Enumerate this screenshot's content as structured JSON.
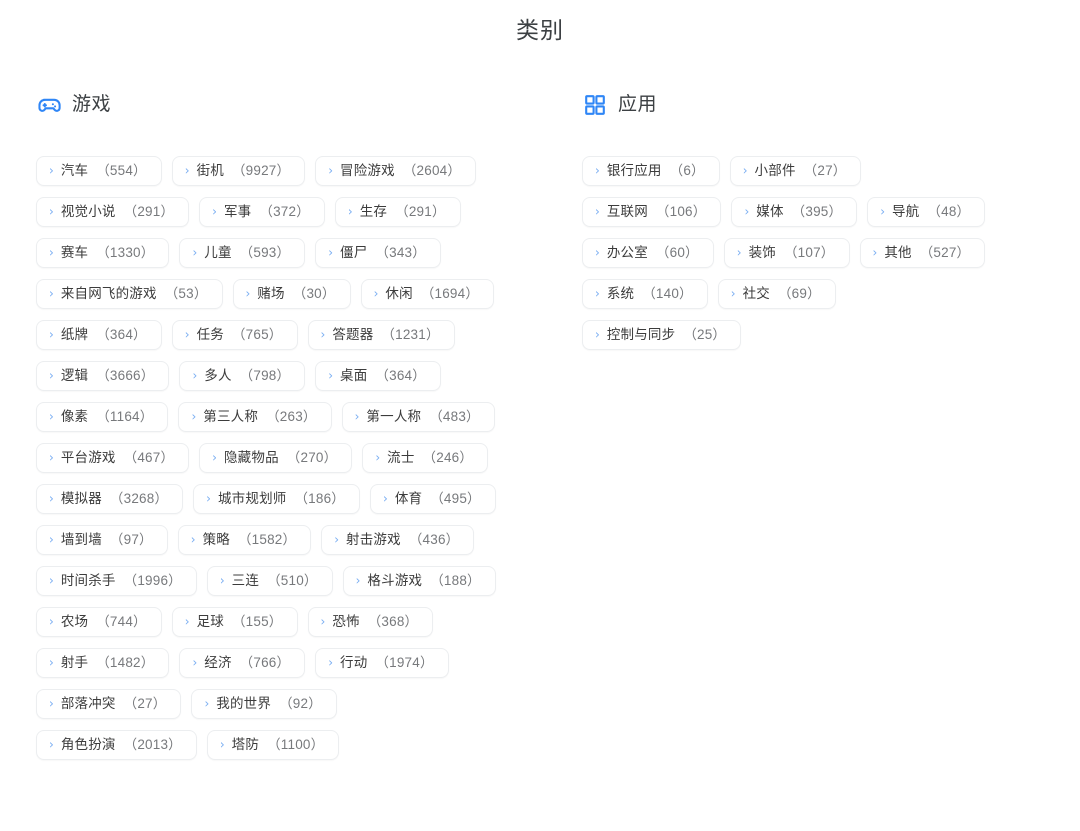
{
  "page": {
    "title": "类别",
    "background": "#ffffff",
    "accent_color": "#2f86f6",
    "chevron_color": "#7aaef2",
    "label_color": "#3c3c3c",
    "count_color": "#77797c",
    "border_color": "#eceef0"
  },
  "sections": [
    {
      "id": "games",
      "icon": "gamepad-icon",
      "title": "游戏",
      "tags": [
        {
          "chevron": "›",
          "label": "汽车",
          "count": "（554）"
        },
        {
          "chevron": "›",
          "label": "街机",
          "count": "（9927）"
        },
        {
          "chevron": "›",
          "label": "冒险游戏",
          "count": "（2604）"
        },
        {
          "chevron": "›",
          "label": "视觉小说",
          "count": "（291）"
        },
        {
          "chevron": "›",
          "label": "军事",
          "count": "（372）"
        },
        {
          "chevron": "›",
          "label": "生存",
          "count": "（291）"
        },
        {
          "chevron": "›",
          "label": "赛车",
          "count": "（1330）"
        },
        {
          "chevron": "›",
          "label": "儿童",
          "count": "（593）"
        },
        {
          "chevron": "›",
          "label": "僵尸",
          "count": "（343）"
        },
        {
          "chevron": "›",
          "label": "来自网飞的游戏",
          "count": "（53）"
        },
        {
          "chevron": "›",
          "label": "赌场",
          "count": "（30）"
        },
        {
          "chevron": "›",
          "label": "休闲",
          "count": "（1694）"
        },
        {
          "chevron": "›",
          "label": "纸牌",
          "count": "（364）"
        },
        {
          "chevron": "›",
          "label": "任务",
          "count": "（765）"
        },
        {
          "chevron": "›",
          "label": "答题器",
          "count": "（1231）"
        },
        {
          "chevron": "›",
          "label": "逻辑",
          "count": "（3666）"
        },
        {
          "chevron": "›",
          "label": "多人",
          "count": "（798）"
        },
        {
          "chevron": "›",
          "label": "桌面",
          "count": "（364）"
        },
        {
          "chevron": "›",
          "label": "像素",
          "count": "（1164）"
        },
        {
          "chevron": "›",
          "label": "第三人称",
          "count": "（263）"
        },
        {
          "chevron": "›",
          "label": "第一人称",
          "count": "（483）"
        },
        {
          "chevron": "›",
          "label": "平台游戏",
          "count": "（467）"
        },
        {
          "chevron": "›",
          "label": "隐藏物品",
          "count": "（270）"
        },
        {
          "chevron": "›",
          "label": "流士",
          "count": "（246）"
        },
        {
          "chevron": "›",
          "label": "模拟器",
          "count": "（3268）"
        },
        {
          "chevron": "›",
          "label": "城市规划师",
          "count": "（186）"
        },
        {
          "chevron": "›",
          "label": "体育",
          "count": "（495）"
        },
        {
          "chevron": "›",
          "label": "墙到墙",
          "count": "（97）"
        },
        {
          "chevron": "›",
          "label": "策略",
          "count": "（1582）"
        },
        {
          "chevron": "›",
          "label": "射击游戏",
          "count": "（436）"
        },
        {
          "chevron": "›",
          "label": "时间杀手",
          "count": "（1996）"
        },
        {
          "chevron": "›",
          "label": "三连",
          "count": "（510）"
        },
        {
          "chevron": "›",
          "label": "格斗游戏",
          "count": "（188）"
        },
        {
          "chevron": "›",
          "label": "农场",
          "count": "（744）"
        },
        {
          "chevron": "›",
          "label": "足球",
          "count": "（155）"
        },
        {
          "chevron": "›",
          "label": "恐怖",
          "count": "（368）"
        },
        {
          "chevron": "›",
          "label": "射手",
          "count": "（1482）"
        },
        {
          "chevron": "›",
          "label": "经济",
          "count": "（766）"
        },
        {
          "chevron": "›",
          "label": "行动",
          "count": "（1974）"
        },
        {
          "chevron": "›",
          "label": "部落冲突",
          "count": "（27）"
        },
        {
          "chevron": "›",
          "label": "我的世界",
          "count": "（92）"
        },
        {
          "chevron": "›",
          "label": "角色扮演",
          "count": "（2013）"
        },
        {
          "chevron": "›",
          "label": "塔防",
          "count": "（1100）"
        }
      ]
    },
    {
      "id": "apps",
      "icon": "grid-squares-icon",
      "title": "应用",
      "tags": [
        {
          "chevron": "›",
          "label": "银行应用",
          "count": "（6）"
        },
        {
          "chevron": "›",
          "label": "小部件",
          "count": "（27）"
        },
        {
          "chevron": "›",
          "label": "互联网",
          "count": "（106）"
        },
        {
          "chevron": "›",
          "label": "媒体",
          "count": "（395）"
        },
        {
          "chevron": "›",
          "label": "导航",
          "count": "（48）"
        },
        {
          "chevron": "›",
          "label": "办公室",
          "count": "（60）"
        },
        {
          "chevron": "›",
          "label": "装饰",
          "count": "（107）"
        },
        {
          "chevron": "›",
          "label": "其他",
          "count": "（527）"
        },
        {
          "chevron": "›",
          "label": "系统",
          "count": "（140）"
        },
        {
          "chevron": "›",
          "label": "社交",
          "count": "（69）"
        },
        {
          "chevron": "›",
          "label": "控制与同步",
          "count": "（25）"
        }
      ]
    }
  ]
}
